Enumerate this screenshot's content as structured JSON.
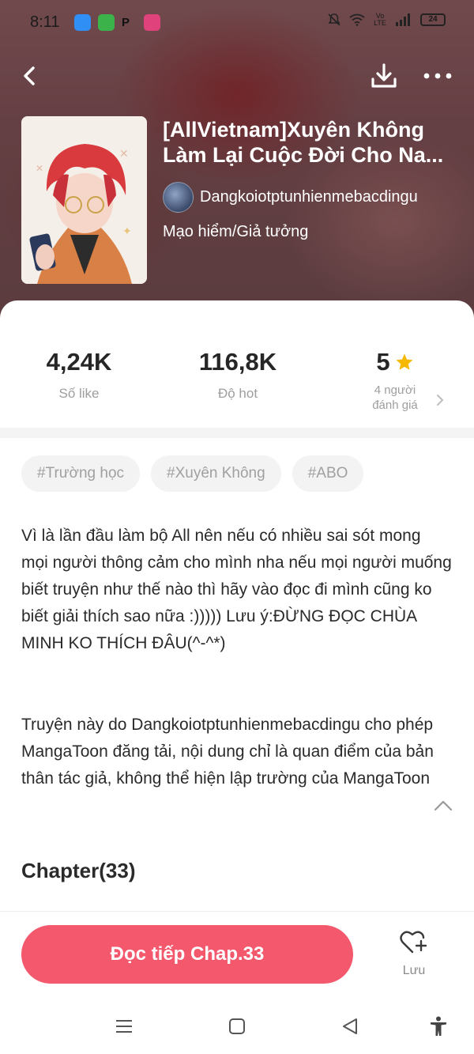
{
  "status_bar": {
    "time": "8:11",
    "battery": "24",
    "network": "Vo LTE"
  },
  "book": {
    "title": "[AllVietnam]Xuyên Không Làm Lại Cuộc Đời Cho Na...",
    "author": "Dangkoiotptunhienmebacdingu",
    "genre": "Mạo hiểm/Giả tưởng"
  },
  "stats": {
    "likes_value": "4,24K",
    "likes_label": "Số like",
    "hot_value": "116,8K",
    "hot_label": "Độ hot",
    "rating_value": "5",
    "rating_count_line1": "4 người",
    "rating_count_line2": "đánh giá"
  },
  "tags": [
    "#Trường học",
    "#Xuyên Không",
    "#ABO"
  ],
  "description": "Vì là lần đầu làm bộ All nên nếu có nhiều sai sót mong mọi người thông cảm cho mình nha nếu mọi người muống biết truyện như thế nào thì hãy vào đọc đi mình cũng ko biết giải thích sao nữa :))))) Lưu ý:ĐỪNG ĐỌC CHÙA MINH KO THÍCH ĐÂU(^-^*)",
  "permission_note": "Truyện này do Dangkoiotptunhienmebacdingu cho phép MangaToon đăng tải, nội dung chỉ là quan điểm của bản thân tác giả, không thể hiện lập trường của MangaToon",
  "chapters": {
    "heading": "Chapter(33)"
  },
  "bottom": {
    "read_button": "Đọc tiếp Chap.33",
    "save_label": "Lưu"
  },
  "colors": {
    "accent": "#f4586c",
    "star": "#f6b800",
    "tag_bg": "#f3f3f3",
    "tag_text": "#a0a0a0"
  },
  "icons": {
    "back": "chevron-left-icon",
    "download": "download-icon",
    "more": "more-dots-icon",
    "star": "star-icon",
    "collapse": "chevron-up-icon",
    "save": "heart-plus-icon"
  }
}
